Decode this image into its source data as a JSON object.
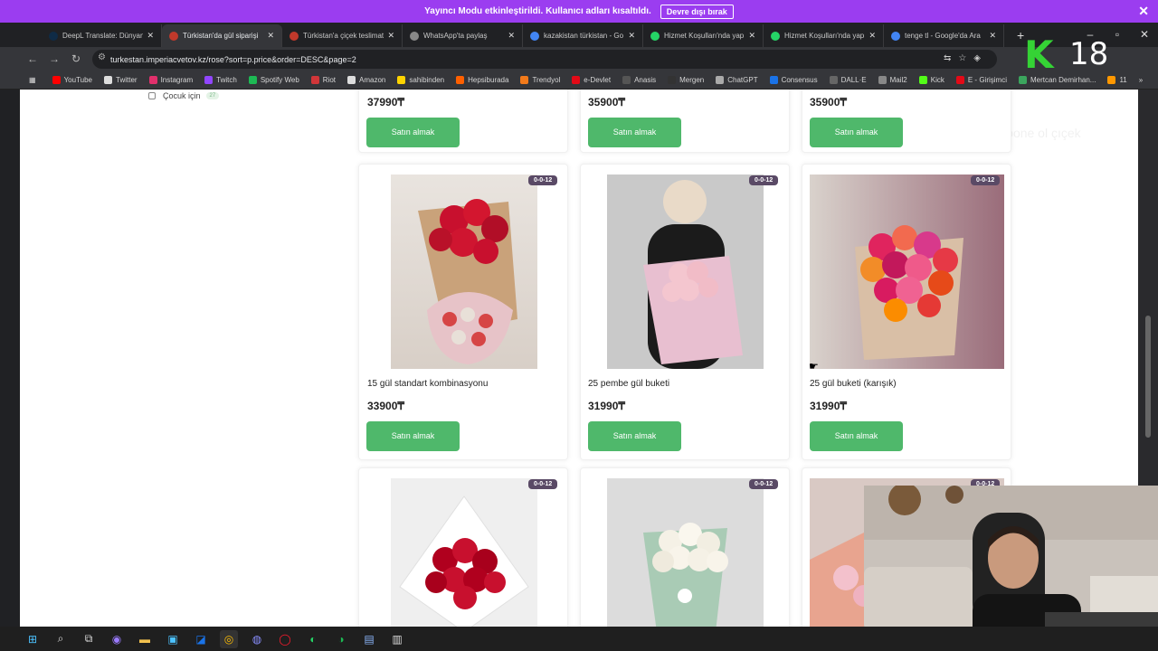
{
  "notice": {
    "text": "Yayıncı Modu etkinleştirildi. Kullanıcı adları kısaltıldı.",
    "button": "Devre dışı bırak"
  },
  "tabs": [
    {
      "label": "DeepL Translate: Dünyan",
      "color": "#0f2b46",
      "active": false
    },
    {
      "label": "Türkistan'da gül siparişi",
      "color": "#c0392b",
      "active": true
    },
    {
      "label": "Türkistan'a çiçek teslimat",
      "color": "#c0392b",
      "active": false
    },
    {
      "label": "WhatsApp'ta paylaş",
      "color": "#888888",
      "active": false
    },
    {
      "label": "kazakistan türkistan - Go",
      "color": "#4285f4",
      "active": false
    },
    {
      "label": "Hizmet Koşulları'nda yap",
      "color": "#25d366",
      "active": false
    },
    {
      "label": "Hizmet Koşulları'nda yap",
      "color": "#25d366",
      "active": false
    },
    {
      "label": "tenge tl - Google'da Ara",
      "color": "#4285f4",
      "active": false
    }
  ],
  "address": "turkestan.imperiacvetov.kz/rose?sort=p.price&order=DESC&page=2",
  "bookmarks": [
    {
      "label": "YouTube",
      "color": "#ff0000"
    },
    {
      "label": "Twitter",
      "color": "#dddddd"
    },
    {
      "label": "Instagram",
      "color": "#e1306c"
    },
    {
      "label": "Twitch",
      "color": "#9146ff"
    },
    {
      "label": "Spotify Web",
      "color": "#1db954"
    },
    {
      "label": "Riot",
      "color": "#d13639"
    },
    {
      "label": "Amazon",
      "color": "#dddddd"
    },
    {
      "label": "sahibinden",
      "color": "#ffd400"
    },
    {
      "label": "Hepsiburada",
      "color": "#ff6000"
    },
    {
      "label": "Trendyol",
      "color": "#f27a1a"
    },
    {
      "label": "e-Devlet",
      "color": "#e30a17"
    },
    {
      "label": "Anasis",
      "color": "#555555"
    },
    {
      "label": "Mergen",
      "color": "#333333"
    },
    {
      "label": "ChatGPT",
      "color": "#aaaaaa"
    },
    {
      "label": "Consensus",
      "color": "#1a73e8"
    },
    {
      "label": "DALL·E",
      "color": "#666666"
    },
    {
      "label": "Mail2",
      "color": "#888888"
    },
    {
      "label": "Kick",
      "color": "#53fc18"
    },
    {
      "label": "E - Girişimci",
      "color": "#e30a17"
    },
    {
      "label": "Mertcan Demirhan...",
      "color": "#3ba55d"
    },
    {
      "label": "11",
      "color": "#ff9800"
    }
  ],
  "overlay": {
    "k": "K",
    "number": "18"
  },
  "ghost_text": "Sana Abone ol çıçek",
  "filter": {
    "label": "Çocuk için",
    "count": "27"
  },
  "products_top": [
    {
      "price": "37990₸",
      "button": "Satın almak"
    },
    {
      "price": "35900₸",
      "button": "Satın almak"
    },
    {
      "price": "35900₸",
      "button": "Satın almak"
    }
  ],
  "products_mid": [
    {
      "badge": "0-0-12",
      "name": "15 gül standart kombinasyonu",
      "price": "33900₸",
      "button": "Satın almak"
    },
    {
      "badge": "0-0-12",
      "name": "25 pembe gül buketi",
      "price": "31990₸",
      "button": "Satın almak"
    },
    {
      "badge": "0-0-12",
      "name": "25 gül buketi (karışık)",
      "price": "31990₸",
      "button": "Satın almak"
    }
  ],
  "products_bottom": [
    {
      "badge": "0-0-12"
    },
    {
      "badge": "0-0-12"
    },
    {
      "badge": "0-0-12"
    }
  ],
  "colors": {
    "accent": "#4fb86b",
    "notice": "#9b3df0",
    "badge": "#5a4a66"
  }
}
